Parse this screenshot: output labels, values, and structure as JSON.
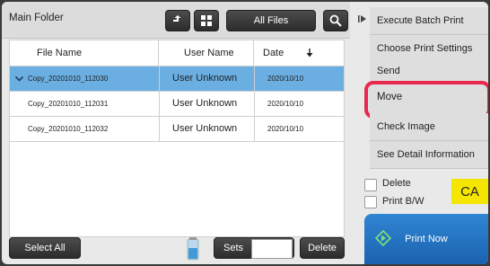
{
  "header": {
    "folder_title": "Main Folder",
    "all_files_label": "All Files"
  },
  "table": {
    "columns": [
      "File Name",
      "User Name",
      "Date"
    ],
    "rows": [
      {
        "file": "Copy_20201010_112030",
        "user": "User Unknown",
        "date": "2020/10/10",
        "selected": true
      },
      {
        "file": "Copy_20201010_112031",
        "user": "User Unknown",
        "date": "2020/10/10",
        "selected": false
      },
      {
        "file": "Copy_20201010_112032",
        "user": "User Unknown",
        "date": "2020/10/10",
        "selected": false
      }
    ]
  },
  "bottom": {
    "select_all_label": "Select All",
    "sets_label": "Sets",
    "sets_value": "",
    "delete_label": "Delete"
  },
  "menu": {
    "items": [
      "Execute Batch Print",
      "Choose Print Settings",
      "Send",
      "Move",
      "Check Image",
      "See Detail Information"
    ]
  },
  "options": {
    "delete_label": "Delete",
    "print_bw_label": "Print B/W",
    "ca_label": "CA",
    "print_now_label": "Print Now"
  },
  "colors": {
    "selected_row": "#6aaee2",
    "highlight": "#e8284f",
    "ca_button": "#f4e600",
    "print_button": "#2f86d2"
  },
  "icons": [
    "up-folder-icon",
    "grid-view-icon",
    "search-icon",
    "sort-down-arrow-icon",
    "collapse-arrow-icon",
    "toner-icon",
    "print-start-icon",
    "checkmark-icon"
  ]
}
